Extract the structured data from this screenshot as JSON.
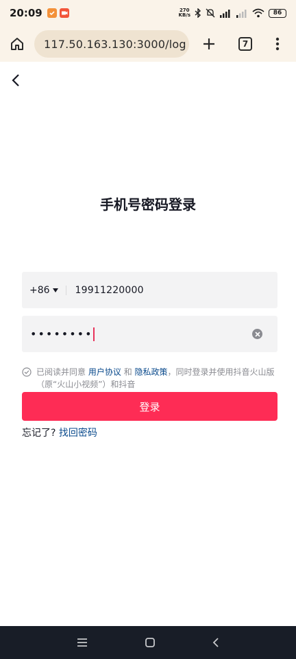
{
  "status_bar": {
    "time": "20:09",
    "net_speed_value": "270",
    "net_speed_unit": "KB/s",
    "battery": "86"
  },
  "browser": {
    "url": "117.50.163.130:3000/log",
    "tab_count": "7"
  },
  "page": {
    "title": "手机号密码登录",
    "country_code": "+86",
    "phone_value": "19911220000",
    "password_masked": "••••••••",
    "agreement": {
      "prefix": "已阅读并同意",
      "user_agreement": "用户协议",
      "and": "和",
      "privacy_policy": "隐私政策",
      "suffix": "，同时登录并使用抖音火山版（原“火山小视频”）和抖音"
    },
    "login_label": "登录",
    "forgot_prefix": "忘记了?",
    "forgot_link": "找回密码"
  },
  "colors": {
    "accent": "#fe2c55",
    "link": "#0a4a8c",
    "browser_chrome": "#faf3e9"
  },
  "icons": {
    "home": "home-icon",
    "warning": "warning-icon",
    "plus": "plus-icon",
    "menu": "more-vert-icon",
    "back": "chevron-left-icon",
    "clear": "clear-icon",
    "check": "check-circle-icon"
  }
}
